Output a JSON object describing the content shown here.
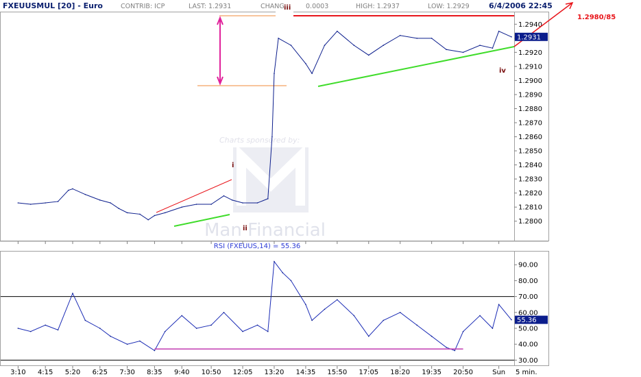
{
  "header": {
    "symbol": "FXEUUSMUL [20] - Euro",
    "contrib": "CONTRIB: ICP",
    "last": "LAST: 1.2931",
    "change_label": "CHANG",
    "change_value": "0.0003",
    "high": "HIGH: 1.2937",
    "low": "LOW: 1.2929",
    "datetime": "6/4/2006 22:45"
  },
  "watermark": {
    "sponsor_text": "Charts sponsored by:",
    "brand_text": "Man Financial"
  },
  "annotations": {
    "wave_i": "i",
    "wave_ii": "ii",
    "wave_iii": "iii",
    "wave_iv": "iv",
    "target": "1.2980/85"
  },
  "colors": {
    "price_line": "#0b1d8c",
    "rsi_line": "#1a2bb5",
    "red": "#e8141a",
    "green": "#3fdc2a",
    "orange": "#f0883a",
    "magenta": "#e0209a",
    "wave_label": "#7a1010",
    "rsi_level": "#c03ab0",
    "last_badge": "#0b1d8c"
  },
  "chart_data": [
    {
      "type": "line",
      "series": [
        {
          "values": [
            {
              "x": "3:10",
              "y": 1.2813
            },
            {
              "x": "3:40",
              "y": 1.2812
            },
            {
              "x": "4:15",
              "y": 1.2813
            },
            {
              "x": "4:45",
              "y": 1.2814
            },
            {
              "x": "5:10",
              "y": 1.2822
            },
            {
              "x": "5:20",
              "y": 1.2823
            },
            {
              "x": "5:50",
              "y": 1.2819
            },
            {
              "x": "6:25",
              "y": 1.2815
            },
            {
              "x": "6:50",
              "y": 1.2813
            },
            {
              "x": "7:10",
              "y": 1.2809
            },
            {
              "x": "7:30",
              "y": 1.2806
            },
            {
              "x": "8:00",
              "y": 1.2805
            },
            {
              "x": "8:20",
              "y": 1.2801
            },
            {
              "x": "8:35",
              "y": 1.2804
            },
            {
              "x": "9:00",
              "y": 1.2806
            },
            {
              "x": "9:40",
              "y": 1.281
            },
            {
              "x": "10:15",
              "y": 1.2812
            },
            {
              "x": "10:50",
              "y": 1.2812
            },
            {
              "x": "11:20",
              "y": 1.2818
            },
            {
              "x": "11:40",
              "y": 1.2815
            },
            {
              "x": "12:05",
              "y": 1.2813
            },
            {
              "x": "12:40",
              "y": 1.2813
            },
            {
              "x": "13:05",
              "y": 1.2816
            },
            {
              "x": "13:15",
              "y": 1.286
            },
            {
              "x": "13:20",
              "y": 1.2905
            },
            {
              "x": "13:30",
              "y": 1.293
            },
            {
              "x": "14:00",
              "y": 1.2925
            },
            {
              "x": "14:35",
              "y": 1.2912
            },
            {
              "x": "14:50",
              "y": 1.2905
            },
            {
              "x": "15:20",
              "y": 1.2925
            },
            {
              "x": "15:50",
              "y": 1.2935
            },
            {
              "x": "16:30",
              "y": 1.2925
            },
            {
              "x": "17:05",
              "y": 1.2918
            },
            {
              "x": "17:40",
              "y": 1.2925
            },
            {
              "x": "18:20",
              "y": 1.2932
            },
            {
              "x": "19:00",
              "y": 1.293
            },
            {
              "x": "19:35",
              "y": 1.293
            },
            {
              "x": "20:10",
              "y": 1.2922
            },
            {
              "x": "20:50",
              "y": 1.292
            },
            {
              "x": "21:30",
              "y": 1.2925
            },
            {
              "x": "22:00",
              "y": 1.2923
            },
            {
              "x": "Sun",
              "y": 1.2935
            },
            {
              "x": "22:45",
              "y": 1.2931
            }
          ]
        }
      ],
      "ylim": [
        1.2794,
        1.2946
      ],
      "yticks": [
        "1.2940",
        "1.2930",
        "1.2920",
        "1.2910",
        "1.2900",
        "1.2890",
        "1.2880",
        "1.2870",
        "1.2860",
        "1.2850",
        "1.2840",
        "1.2830",
        "1.2820",
        "1.2810",
        "1.2800"
      ],
      "last_value_label": "1.2931",
      "resistance_line": 1.294,
      "grid": false
    },
    {
      "type": "line",
      "title": "RSI (FXEUUS,14) = 55.36",
      "series": [
        {
          "values": [
            {
              "x": "3:10",
              "y": 50
            },
            {
              "x": "3:40",
              "y": 48
            },
            {
              "x": "4:15",
              "y": 52
            },
            {
              "x": "4:45",
              "y": 49
            },
            {
              "x": "5:20",
              "y": 72
            },
            {
              "x": "5:50",
              "y": 55
            },
            {
              "x": "6:25",
              "y": 50
            },
            {
              "x": "6:50",
              "y": 45
            },
            {
              "x": "7:30",
              "y": 40
            },
            {
              "x": "8:00",
              "y": 42
            },
            {
              "x": "8:35",
              "y": 36
            },
            {
              "x": "9:00",
              "y": 48
            },
            {
              "x": "9:40",
              "y": 58
            },
            {
              "x": "10:15",
              "y": 50
            },
            {
              "x": "10:50",
              "y": 52
            },
            {
              "x": "11:20",
              "y": 60
            },
            {
              "x": "12:05",
              "y": 48
            },
            {
              "x": "12:40",
              "y": 52
            },
            {
              "x": "13:05",
              "y": 48
            },
            {
              "x": "13:20",
              "y": 92
            },
            {
              "x": "13:40",
              "y": 85
            },
            {
              "x": "14:00",
              "y": 80
            },
            {
              "x": "14:35",
              "y": 65
            },
            {
              "x": "14:50",
              "y": 55
            },
            {
              "x": "15:20",
              "y": 62
            },
            {
              "x": "15:50",
              "y": 68
            },
            {
              "x": "16:30",
              "y": 58
            },
            {
              "x": "17:05",
              "y": 45
            },
            {
              "x": "17:40",
              "y": 55
            },
            {
              "x": "18:20",
              "y": 60
            },
            {
              "x": "19:00",
              "y": 52
            },
            {
              "x": "19:35",
              "y": 45
            },
            {
              "x": "20:10",
              "y": 38
            },
            {
              "x": "20:30",
              "y": 36
            },
            {
              "x": "20:50",
              "y": 48
            },
            {
              "x": "21:30",
              "y": 58
            },
            {
              "x": "22:00",
              "y": 50
            },
            {
              "x": "Sun",
              "y": 65
            },
            {
              "x": "22:45",
              "y": 55.36
            }
          ]
        }
      ],
      "ylim": [
        28,
        97
      ],
      "yticks": [
        "90.00",
        "80.00",
        "70.00",
        "60.00",
        "50.00",
        "40.00",
        "30.00"
      ],
      "last_value_label": "55.36",
      "reference_lines": [
        70,
        30
      ],
      "support_line": 37,
      "grid": false
    }
  ],
  "x_axis": {
    "tick_labels": [
      "3:10",
      "4:15",
      "5:20",
      "6:25",
      "7:30",
      "8:35",
      "9:40",
      "10:50",
      "12:05",
      "13:20",
      "14:35",
      "15:50",
      "17:05",
      "18:20",
      "19:35",
      "20:50",
      "Sun"
    ],
    "unit_label": "5 min."
  }
}
